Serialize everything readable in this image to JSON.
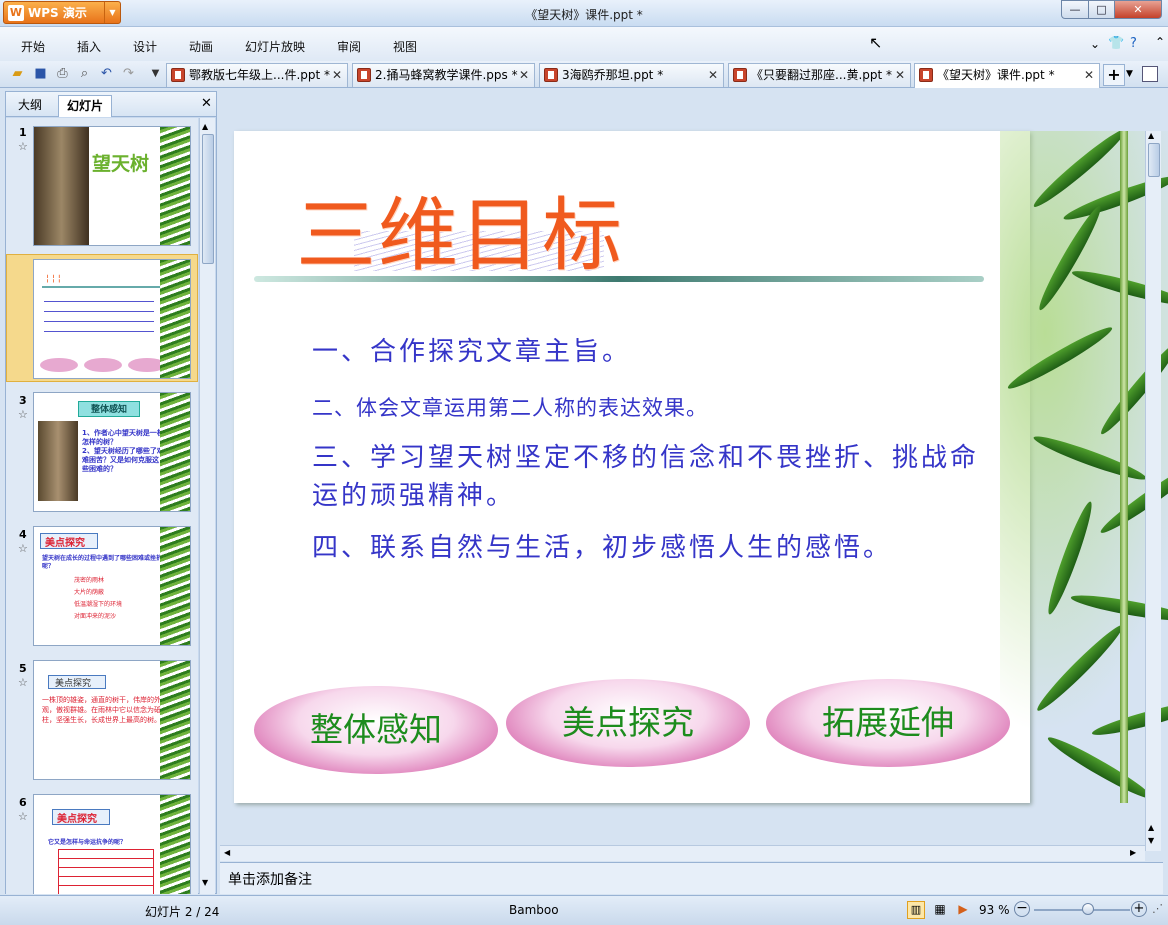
{
  "app": {
    "name": "WPS 演示",
    "window_title": "《望天树》课件.ppt *"
  },
  "menu": [
    "开始",
    "插入",
    "设计",
    "动画",
    "幻灯片放映",
    "审阅",
    "视图"
  ],
  "tabs": [
    {
      "label": "鄂教版七年级上...件.ppt *",
      "active": false
    },
    {
      "label": "2.捅马蜂窝教学课件.pps *",
      "active": false
    },
    {
      "label": "3海鸥乔那坦.ppt *",
      "active": false
    },
    {
      "label": "《只要翻过那座...黄.ppt *",
      "active": false
    },
    {
      "label": "《望天树》课件.ppt *",
      "active": true
    }
  ],
  "panel": {
    "tab_outline": "大纲",
    "tab_slides": "幻灯片"
  },
  "thumbnails": [
    {
      "num": "1",
      "title": "望天树"
    },
    {
      "num": "2"
    },
    {
      "num": "3",
      "title": "整体感知",
      "lines": [
        "1、作者心中望天树是一棵怎样的树？",
        "2、望天树经历了哪些了艰难困苦？又是如何克服这些困难的？"
      ]
    },
    {
      "num": "4",
      "title": "美点探究",
      "lines": [
        "望天树在成长的过程中遇到了哪些困难或挫折呢？",
        "茂密的雨林",
        "大片的荫蔽",
        "低温潮湿下的环境",
        "对面冲来的泥沙"
      ]
    },
    {
      "num": "5",
      "title": "美点探究",
      "lines": [
        "一株顶的雄姿，通直的树干，伟岸的外观，傲视群雄。在雨林中它以信念为砥柱，坚强生长，长成世界上最高的树。"
      ]
    },
    {
      "num": "6",
      "title": "美点探究",
      "lines": [
        "它又是怎样与命运抗争的呢？"
      ]
    }
  ],
  "slide": {
    "title": "三维目标",
    "objectives": [
      "一、合作探究文章主旨。",
      "二、体会文章运用第二人称的表达效果。",
      "三、学习望天树坚定不移的信念和不畏挫折、挑战命运的顽强精神。",
      "四、联系自然与生活，初步感悟人生的感悟。"
    ],
    "buttons": [
      "整体感知",
      "美点探究",
      "拓展延伸"
    ]
  },
  "notes_placeholder": "单击添加备注",
  "status": {
    "slide_counter": "幻灯片 2 / 24",
    "theme": "Bamboo",
    "zoom": "93 %",
    "zoom_level": 0.6
  },
  "colors": {
    "title": "#f05a1e",
    "body": "#3535c8",
    "button_text": "#1d8c1d"
  }
}
